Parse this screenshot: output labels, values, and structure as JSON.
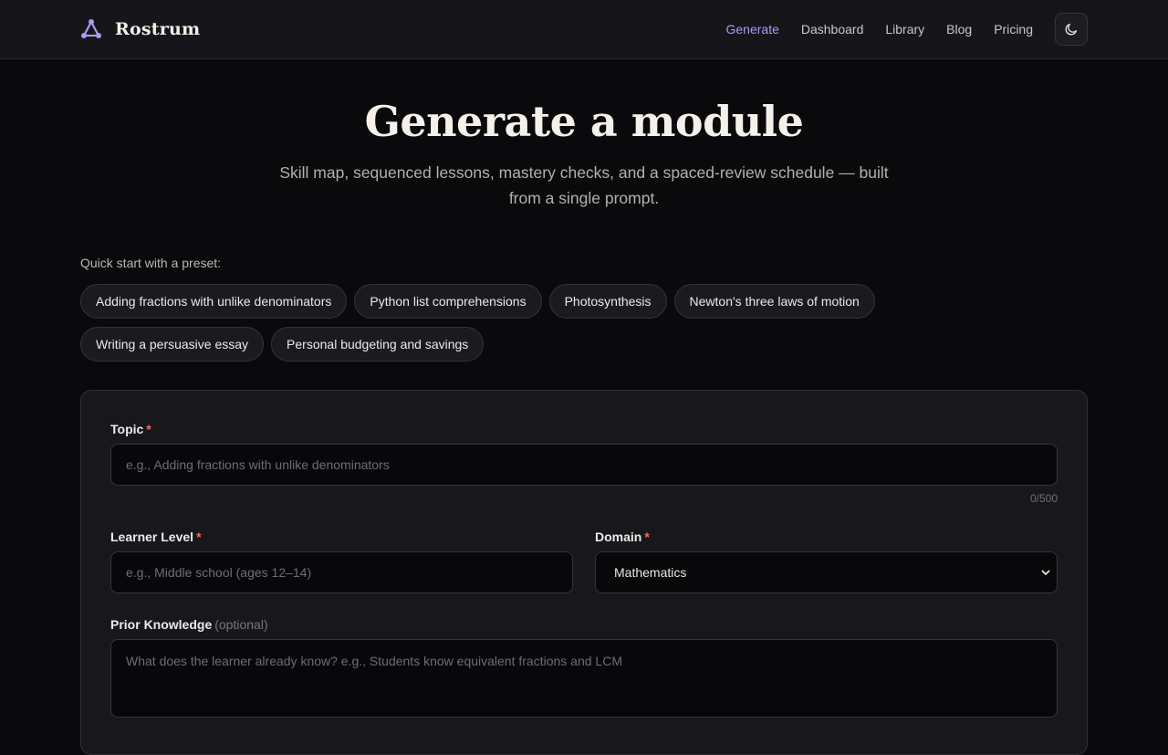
{
  "brand": {
    "name": "Rostrum",
    "icon": "triangle-nodes-icon",
    "accent": "#a89bf5"
  },
  "nav": {
    "items": [
      {
        "label": "Generate",
        "active": true
      },
      {
        "label": "Dashboard",
        "active": false
      },
      {
        "label": "Library",
        "active": false
      },
      {
        "label": "Blog",
        "active": false
      },
      {
        "label": "Pricing",
        "active": false
      }
    ],
    "theme_icon": "moon-icon"
  },
  "hero": {
    "title": "Generate a module",
    "subtitle": "Skill map, sequenced lessons, mastery checks, and a spaced-review schedule — built from a single prompt."
  },
  "presets": {
    "label": "Quick start with a preset:",
    "items": [
      "Adding fractions with unlike denominators",
      "Python list comprehensions",
      "Photosynthesis",
      "Newton's three laws of motion",
      "Writing a persuasive essay",
      "Personal budgeting and savings"
    ]
  },
  "form": {
    "topic": {
      "label": "Topic",
      "required": "*",
      "placeholder": "e.g., Adding fractions with unlike denominators",
      "value": "",
      "counter": "0/500"
    },
    "learner_level": {
      "label": "Learner Level",
      "required": "*",
      "placeholder": "e.g., Middle school (ages 12–14)",
      "value": ""
    },
    "domain": {
      "label": "Domain",
      "required": "*",
      "selected": "Mathematics"
    },
    "prior_knowledge": {
      "label": "Prior Knowledge",
      "optional": "(optional)",
      "placeholder": "What does the learner already know? e.g., Students know equivalent fractions and LCM",
      "value": ""
    }
  },
  "colors": {
    "required_marker": "#f26d6d",
    "background": "#0a0a0d",
    "card": "#18181c"
  }
}
